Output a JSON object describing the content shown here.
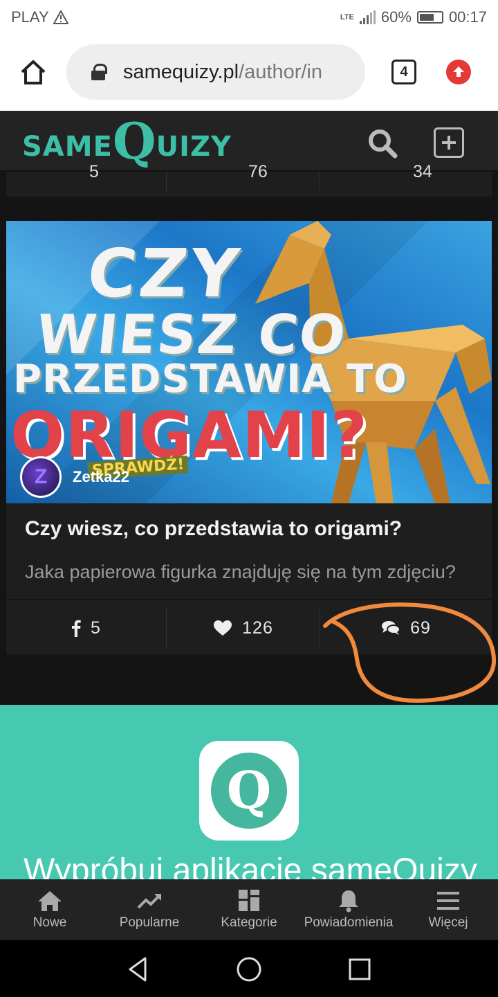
{
  "status_bar": {
    "carrier": "PLAY",
    "network": "LTE",
    "battery": "60%",
    "time": "00:17"
  },
  "browser": {
    "url_domain": "samequizy.pl",
    "url_path": "/author/in",
    "tab_count": "4"
  },
  "site": {
    "logo_left": "SAME",
    "logo_q": "Q",
    "logo_right": "UIZY",
    "brand_color": "#3dbfa7"
  },
  "prev_card": {
    "shares": "5",
    "likes": "76",
    "comments": "34"
  },
  "card": {
    "thumb_line1": "CZY",
    "thumb_line2": "WIESZ CO",
    "thumb_line3": "PRZEDSTAWIA TO",
    "thumb_line4": "ORIGAMI?",
    "thumb_badge": "SPRAWDŹ!",
    "author": "Zetka22",
    "title": "Czy wiesz, co przedstawia to origami?",
    "description": "Jaka papierowa figurka znajduję się na tym zdjęciu?",
    "shares": "5",
    "likes": "126",
    "comments": "69"
  },
  "promo": {
    "app_letter": "Q",
    "text": "Wypróbuj aplikację sameQuizy"
  },
  "bottom_nav": [
    {
      "label": "Nowe",
      "icon": "home-icon"
    },
    {
      "label": "Popularne",
      "icon": "trending-icon"
    },
    {
      "label": "Kategorie",
      "icon": "grid-icon"
    },
    {
      "label": "Powiadomienia",
      "icon": "bell-icon"
    },
    {
      "label": "Więcej",
      "icon": "menu-icon"
    }
  ]
}
